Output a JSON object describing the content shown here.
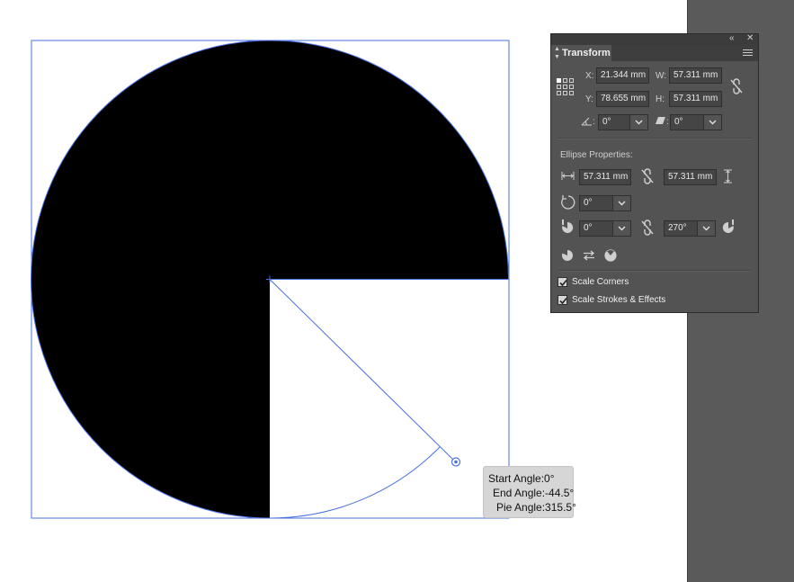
{
  "tooltip": {
    "start_angle": "Start Angle:0°",
    "end_angle": "End Angle:-44.5°",
    "pie_angle": "Pie Angle:315.5°"
  },
  "panel": {
    "tab_label": "Transform",
    "x_label": "X:",
    "x_value": "21.344 mm",
    "y_label": "Y:",
    "y_value": "78.655 mm",
    "w_label": "W:",
    "w_value": "57.311 mm",
    "h_label": "H:",
    "h_value": "57.311 mm",
    "rotate_value": "0°",
    "shear_value": "0°",
    "rotate_suffix": ":",
    "shear_suffix": ":",
    "ellipse_section_title": "Ellipse Properties:",
    "ellipse_width": "57.311 mm",
    "ellipse_height": "57.311 mm",
    "ellipse_rotation": "0°",
    "pie_start": "0°",
    "pie_end": "270°",
    "scale_corners_label": "Scale Corners",
    "scale_corners_checked": true,
    "scale_strokes_label": "Scale Strokes & Effects",
    "scale_strokes_checked": true
  },
  "colors": {
    "selection": "#4a70e0",
    "pie_fill": "#000000",
    "panel_bg": "#535353",
    "rail_bg": "#5a5a5a"
  },
  "icons": {
    "reference_point": "reference-point-grid-icon",
    "constrain": "link-broken-icon",
    "rotate": "rotate-icon",
    "shear": "shear-icon",
    "pie_start": "pie-start-icon",
    "pie_end": "pie-end-icon",
    "invert_pie": "swap-arrows-icon"
  }
}
